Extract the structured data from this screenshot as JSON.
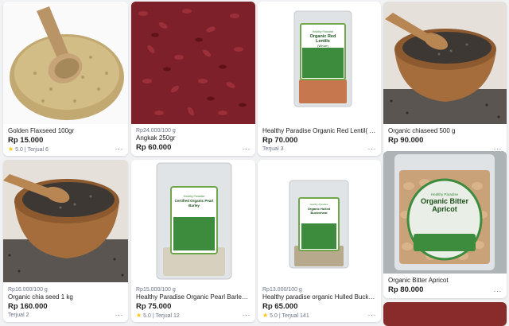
{
  "products": [
    {
      "name": "Golden Flaxseed 100gr",
      "unit_price": "",
      "price": "Rp 15.000",
      "rating": "5.0",
      "sold": "Terjual 6"
    },
    {
      "name": "Angkak 250gr",
      "unit_price": "Rp24.000/100 g",
      "price": "Rp 60.000",
      "rating": "",
      "sold": ""
    },
    {
      "name": "Healthy Paradise Organic Red Lentil( Whole) 250gr",
      "unit_price": "",
      "price": "Rp 70.000",
      "rating": "",
      "sold": "Terjual 3"
    },
    {
      "name": "Organic chiaseed 500 g",
      "unit_price": "",
      "price": "Rp 90.000",
      "rating": "",
      "sold": ""
    },
    {
      "name": "Organic chia seed 1 kg",
      "unit_price": "Rp16.000/100 g",
      "price": "Rp 160.000",
      "rating": "",
      "sold": "Terjual 2"
    },
    {
      "name": "Healthy Paradise Organic Pearl Barley 500gr",
      "unit_price": "Rp15.000/100 g",
      "price": "Rp 75.000",
      "rating": "5.0",
      "sold": "Terjual 12"
    },
    {
      "name": "Healthy paradise organic Hulled Buckwheat 500gr",
      "unit_price": "Rp13.000/100 g",
      "price": "Rp 65.000",
      "rating": "5.0",
      "sold": "Terjual 141"
    },
    {
      "name": "Organic Bitter Apricot",
      "unit_price": "",
      "price": "Rp 80.000",
      "rating": "",
      "sold": ""
    }
  ],
  "pack_labels": {
    "lentil": {
      "brand": "Healthy Paradise",
      "title": "Organic Red Lentils",
      "sub": "(Whole)"
    },
    "barley": {
      "brand": "Healthy Paradise",
      "title": "Certified Organic Pearl Barley"
    },
    "buckwheat": {
      "brand": "Healthy Paradise",
      "title": "Organic Hulled Buckwheat"
    },
    "apricot": {
      "brand": "Healthy Paradise",
      "title": "Organic Bitter Apricot"
    }
  },
  "icons": {
    "star": "star-icon",
    "more": "more-options-icon"
  },
  "colors": {
    "star": "#ffc400",
    "price": "#212121",
    "muted": "#6d7588",
    "label_green": "#1f7a35",
    "card_bg": "#ffffff",
    "page_bg": "#f1f2f4"
  }
}
